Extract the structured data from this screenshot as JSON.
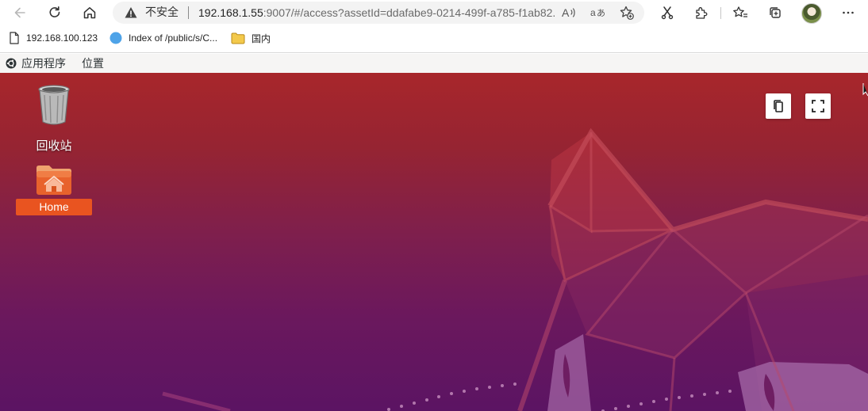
{
  "browser": {
    "address": {
      "security_label": "不安全",
      "url_host": "192.168.1.55",
      "url_path": ":9007/#/access?assetId=ddafabe9-0214-499f-a785-f1ab82..."
    },
    "bookmarks": [
      {
        "label": "192.168.100.123",
        "icon": "page-icon"
      },
      {
        "label": "Index of /public/s/C...",
        "icon": "globe-icon"
      },
      {
        "label": "国内",
        "icon": "folder-icon"
      }
    ]
  },
  "gnome_bar": {
    "applications_label": "应用程序",
    "places_label": "位置"
  },
  "desktop": {
    "trash_label": "回收站",
    "home_label": "Home",
    "accent_color": "#e95420"
  }
}
